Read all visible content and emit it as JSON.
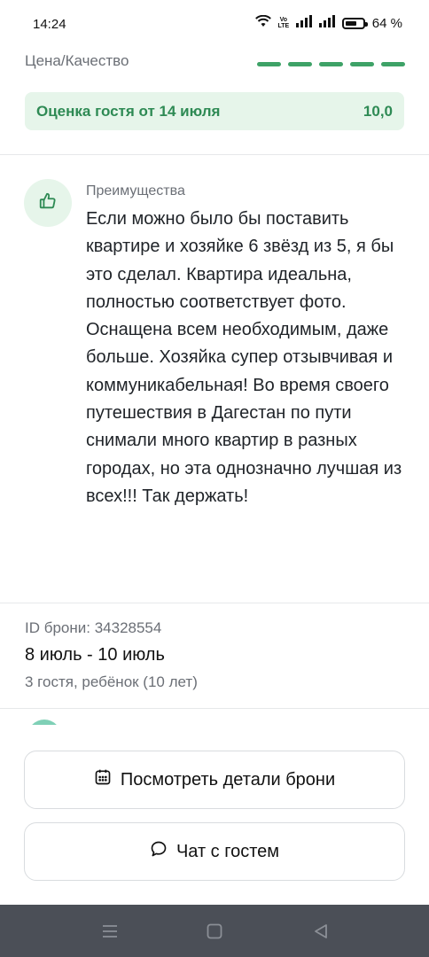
{
  "status_bar": {
    "time": "14:24",
    "volte": "VoLTE",
    "battery_percent": "64 %",
    "battery_level": 0.64
  },
  "rating": {
    "label": "Цена/Качество",
    "segments_filled": 5,
    "segments_total": 5,
    "accent_color": "#3ea267"
  },
  "guest_rating": {
    "label": "Оценка гостя от 14 июля",
    "value": "10,0"
  },
  "advantages": {
    "icon": "thumbs-up-icon",
    "heading": "Преимущества",
    "text": "Если можно было бы поставить квартире и хозяйке 6 звёзд из 5, я бы это сделал. Квартира идеальна, полностью соответствует фото. Оснащена всем необходимым, даже больше. Хозяйка супер отзывчивая и коммуникабельная! Во время своего путешествия в Дагестан по пути снимали много квартир в разных городах, но эта однозначно лучшая из всех!!! Так держать!"
  },
  "booking": {
    "id_text": "ID брони: 34328554",
    "dates": "8 июль - 10 июль",
    "guests": "3 гостя, ребёнок (10 лет)"
  },
  "actions": {
    "details_label": "Посмотреть детали брони",
    "details_icon": "calendar-icon",
    "chat_label": "Чат с гостем",
    "chat_icon": "chat-bubble-icon"
  },
  "nav": {
    "menu_icon": "menu-icon",
    "home_icon": "home-square-icon",
    "back_icon": "back-triangle-icon"
  }
}
